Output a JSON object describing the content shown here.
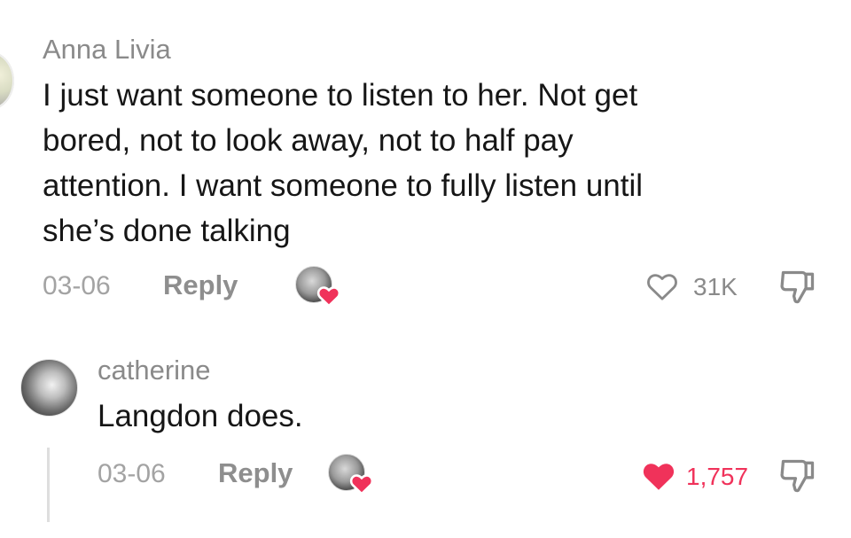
{
  "comments": [
    {
      "author": "Anna Livia",
      "text_lines": [
        "I just want someone to listen to her. Not get",
        "bored, not to look away, not to half pay",
        "attention. I want someone to fully listen until",
        "she’s done talking"
      ],
      "date": "03-06",
      "reply_label": "Reply",
      "like_count": "31K",
      "liked": false,
      "creator_liked": true
    },
    {
      "author": "catherine",
      "text": "Langdon does.",
      "date": "03-06",
      "reply_label": "Reply",
      "like_count": "1,757",
      "liked": true,
      "creator_liked": true
    }
  ],
  "colors": {
    "like_active": "#f0325a",
    "text": "#161616",
    "secondary": "#8a8a8a"
  },
  "icons": {
    "like": "heart-outline-icon",
    "like_active": "heart-filled-icon",
    "dislike": "thumbs-down-icon"
  }
}
